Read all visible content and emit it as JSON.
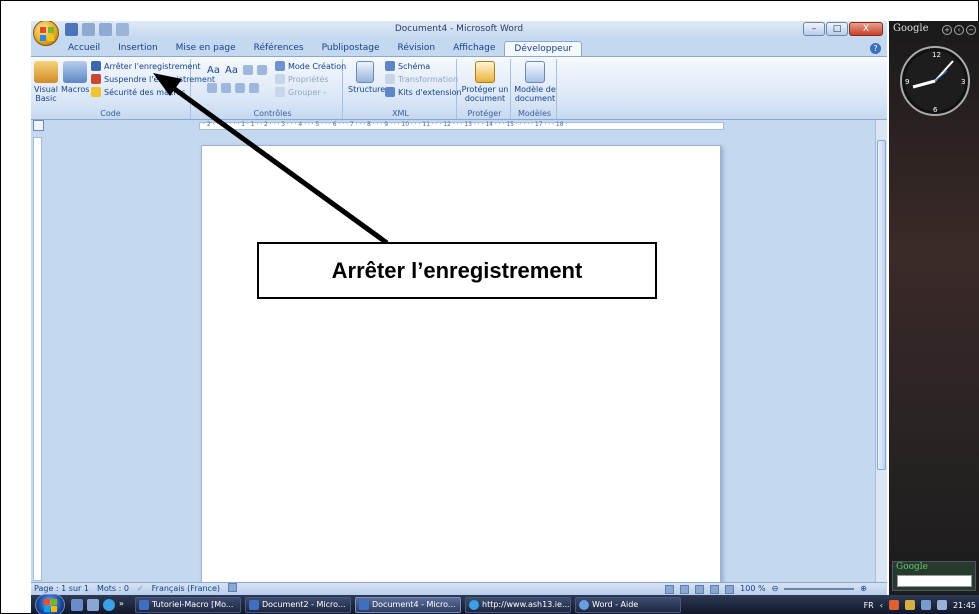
{
  "window": {
    "title": "Document4 - Microsoft Word",
    "controls": {
      "minimize": "–",
      "maximize": "□",
      "close": "X"
    }
  },
  "tabs": [
    {
      "label": "Accueil"
    },
    {
      "label": "Insertion"
    },
    {
      "label": "Mise en page"
    },
    {
      "label": "Références"
    },
    {
      "label": "Publipostage"
    },
    {
      "label": "Révision"
    },
    {
      "label": "Affichage"
    },
    {
      "label": "Développeur",
      "active": true
    }
  ],
  "help": "?",
  "ribbon": {
    "code": {
      "label": "Code",
      "visual_basic": [
        "Visual",
        "Basic"
      ],
      "macros": "Macros",
      "stop_recording": "Arrêter l'enregistrement",
      "pause_recording": "Suspendre l'enregistrement",
      "macro_security": "Sécurité des macros"
    },
    "controls": {
      "label": "Contrôles",
      "aa1": "Aa",
      "aa2": "Aa",
      "design_mode": "Mode Création",
      "properties": "Propriétés",
      "group": "Grouper -"
    },
    "xml": {
      "label": "XML",
      "structure": "Structure",
      "schema": "Schéma",
      "transformation": "Transformation",
      "expansion_packs": "Kits d'extension"
    },
    "protect": {
      "label": "Protéger",
      "protect_document": [
        "Protéger un",
        "document"
      ]
    },
    "templates": {
      "label": "Modèles",
      "document_template": [
        "Modèle de",
        "document"
      ]
    }
  },
  "ruler": "· 2 · · 1 · · · · 1 · 1 · · 2 · · · 3 · · · 4 · · · 5 · · · 6 · · · 7 · · · 8 · · · 9 · · · 10 · · · 11 · · · 12 · · · 13 · · · 14 · · · 15 · · · · · 17 · · · 18 ·",
  "status": {
    "page": "Page : 1 sur 1",
    "words": "Mots : 0",
    "language": "Français (France)",
    "zoom": "100 %"
  },
  "sidebar": {
    "title": "Google",
    "gadget_label": "Google"
  },
  "taskbar": {
    "tasks": [
      {
        "label": "Tutoriel-Macro [Mo..."
      },
      {
        "label": "Document2 - Micro..."
      },
      {
        "label": "Document4 - Micro...",
        "active": true
      },
      {
        "label": "http://www.ash13.ie..."
      },
      {
        "label": "Word - Aide"
      }
    ],
    "lang": "FR",
    "time": "21:45"
  },
  "annotation": {
    "callout": "Arrêter l’enregistrement"
  },
  "colors": {
    "ribbon_blue": "#c4d8ef",
    "accent": "#15428b"
  }
}
